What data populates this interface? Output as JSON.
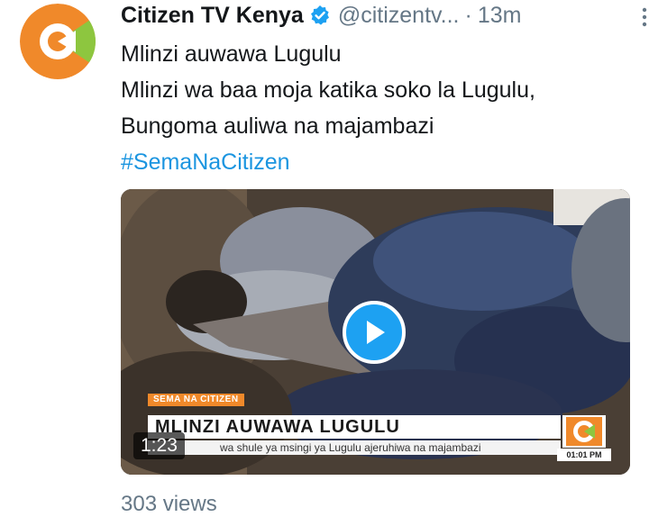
{
  "tweet": {
    "author_name": "Citizen TV Kenya",
    "handle": "@citizentv...",
    "separator": "·",
    "time": "13m",
    "text_lines": [
      "Mlinzi auwawa Lugulu",
      "Mlinzi wa baa moja katika soko la Lugulu,",
      "Bungoma auliwa na majambazi"
    ],
    "hashtag": "#SemaNaCitizen",
    "views": "303 views"
  },
  "video": {
    "strap_label": "SEMA NA CITIZEN",
    "headline": "MLINZI AUWAWA LUGULU",
    "ticker": "wa shule ya msingi ya Lugulu ajeruhiwa na majambazi",
    "clock": "01:01 PM",
    "duration": "1:23"
  },
  "colors": {
    "link": "#1b95e0",
    "verified": "#1da1f2",
    "secondary_text": "#657786",
    "brand_orange": "#f0892a",
    "brand_green": "#8dc63f"
  },
  "icons": [
    "verified-badge-icon",
    "more-options-icon",
    "play-icon",
    "citizen-logo-icon"
  ]
}
